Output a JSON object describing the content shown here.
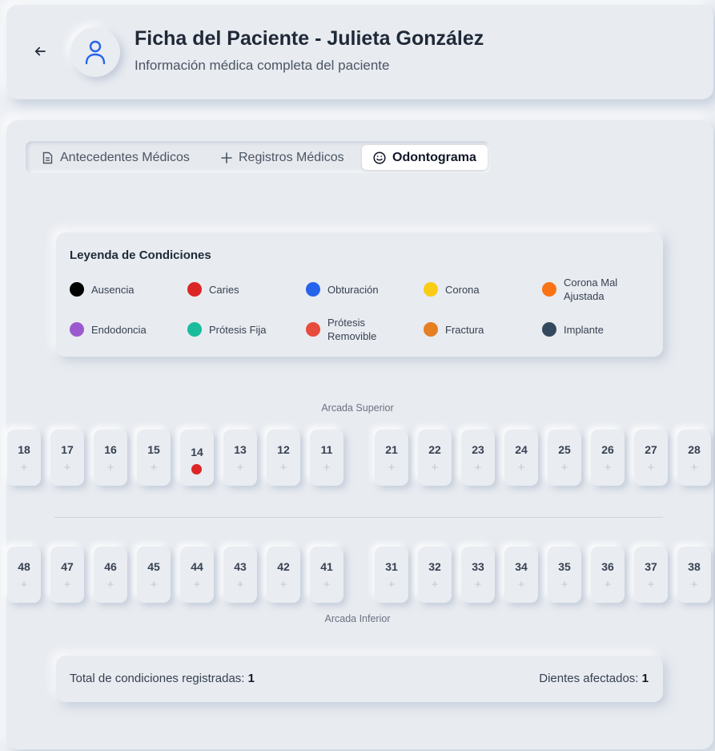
{
  "header": {
    "title": "Ficha del Paciente - Julieta González",
    "subtitle": "Información médica completa del paciente",
    "back_icon": "arrow-left-icon",
    "avatar_icon": "user-icon",
    "accent_color": "#2563eb"
  },
  "tabs": [
    {
      "label": "Antecedentes Médicos",
      "icon": "document-icon",
      "active": false
    },
    {
      "label": "Registros Médicos",
      "icon": "plus-icon",
      "active": false
    },
    {
      "label": "Odontograma",
      "icon": "smile-icon",
      "active": true
    }
  ],
  "legend": {
    "title": "Leyenda de Condiciones",
    "items": [
      {
        "label": "Ausencia",
        "color": "#000000"
      },
      {
        "label": "Caries",
        "color": "#dc2626"
      },
      {
        "label": "Obturación",
        "color": "#2563eb"
      },
      {
        "label": "Corona",
        "color": "#facc15"
      },
      {
        "label": "Corona Mal Ajustada",
        "color": "#f97316"
      },
      {
        "label": "Endodoncia",
        "color": "#9b59d0"
      },
      {
        "label": "Prótesis Fija",
        "color": "#1abc9c"
      },
      {
        "label": "Prótesis Removible",
        "color": "#e74c3c"
      },
      {
        "label": "Fractura",
        "color": "#e67e22"
      },
      {
        "label": "Implante",
        "color": "#34495e"
      }
    ]
  },
  "upper_arch": {
    "label": "Arcada Superior",
    "teeth": [
      {
        "number": "18"
      },
      {
        "number": "17"
      },
      {
        "number": "16"
      },
      {
        "number": "15"
      },
      {
        "number": "14",
        "condition_color": "#dc2626"
      },
      {
        "number": "13"
      },
      {
        "number": "12"
      },
      {
        "number": "11"
      },
      {
        "number": "21"
      },
      {
        "number": "22"
      },
      {
        "number": "23"
      },
      {
        "number": "24"
      },
      {
        "number": "25"
      },
      {
        "number": "26"
      },
      {
        "number": "27"
      },
      {
        "number": "28"
      }
    ]
  },
  "lower_arch": {
    "label": "Arcada Inferior",
    "teeth": [
      {
        "number": "48"
      },
      {
        "number": "47"
      },
      {
        "number": "46"
      },
      {
        "number": "45"
      },
      {
        "number": "44"
      },
      {
        "number": "43"
      },
      {
        "number": "42"
      },
      {
        "number": "41"
      },
      {
        "number": "31"
      },
      {
        "number": "32"
      },
      {
        "number": "33"
      },
      {
        "number": "34"
      },
      {
        "number": "35"
      },
      {
        "number": "36"
      },
      {
        "number": "37"
      },
      {
        "number": "38"
      }
    ]
  },
  "tooth_add_symbol": "+",
  "summary": {
    "total_label": "Total de condiciones registradas:",
    "total_value": "1",
    "affected_label": "Dientes afectados:",
    "affected_value": "1"
  }
}
